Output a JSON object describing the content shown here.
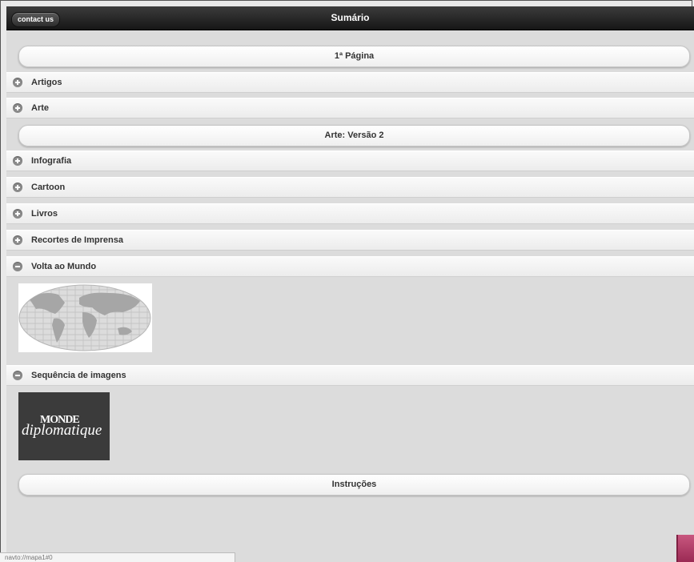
{
  "header": {
    "title": "Sumário",
    "contact_label": "contact us"
  },
  "buttons": {
    "first_page": "1ª Página",
    "arte_v2": "Arte: Versão 2",
    "instructions": "Instruções"
  },
  "sections": [
    {
      "label": "Artigos",
      "expanded": false
    },
    {
      "label": "Arte",
      "expanded": false
    },
    {
      "label": "Infografia",
      "expanded": false
    },
    {
      "label": "Cartoon",
      "expanded": false
    },
    {
      "label": "Livros",
      "expanded": false
    },
    {
      "label": "Recortes de Imprensa",
      "expanded": false
    },
    {
      "label": "Volta ao Mundo",
      "expanded": true
    },
    {
      "label": "Sequência de imagens",
      "expanded": true
    }
  ],
  "logo": {
    "line1": "MONDE",
    "line2": "diplomatique"
  },
  "status": {
    "url": "navto://mapa1#0"
  },
  "icons": {
    "collapsed": "plus-circle-icon",
    "expanded": "minus-circle-icon"
  },
  "colors": {
    "header": "#1e1e1e",
    "accent_corner": "#b0406a"
  }
}
